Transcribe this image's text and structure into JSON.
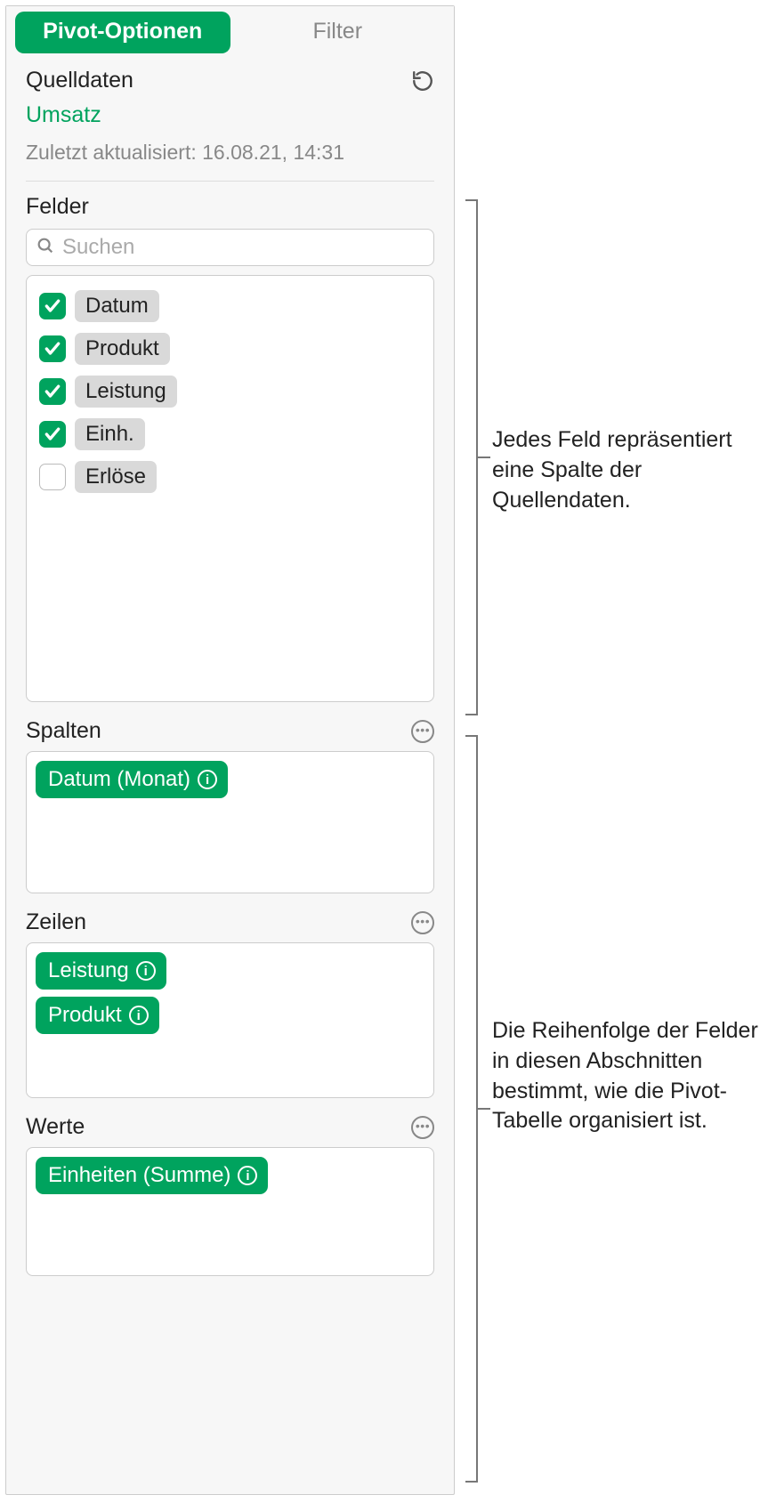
{
  "tabs": {
    "pivot": "Pivot-Optionen",
    "filter": "Filter"
  },
  "source": {
    "heading": "Quelldaten",
    "name": "Umsatz",
    "updated": "Zuletzt aktualisiert: 16.08.21, 14:31"
  },
  "fields": {
    "heading": "Felder",
    "search_placeholder": "Suchen",
    "items": [
      {
        "label": "Datum",
        "checked": true
      },
      {
        "label": "Produkt",
        "checked": true
      },
      {
        "label": "Leistung",
        "checked": true
      },
      {
        "label": "Einh.",
        "checked": true
      },
      {
        "label": "Erlöse",
        "checked": false
      }
    ]
  },
  "columns": {
    "heading": "Spalten",
    "items": [
      {
        "label": "Datum (Monat)"
      }
    ]
  },
  "rows": {
    "heading": "Zeilen",
    "items": [
      {
        "label": "Leistung"
      },
      {
        "label": "Produkt"
      }
    ]
  },
  "values": {
    "heading": "Werte",
    "items": [
      {
        "label": "Einheiten (Summe)"
      }
    ]
  },
  "annotations": {
    "fields": "Jedes Feld repräsentiert eine Spalte der Quellendaten.",
    "sections": "Die Reihenfolge der Felder in diesen Abschnitten bestimmt, wie die Pivot-Tabelle organisiert ist."
  }
}
